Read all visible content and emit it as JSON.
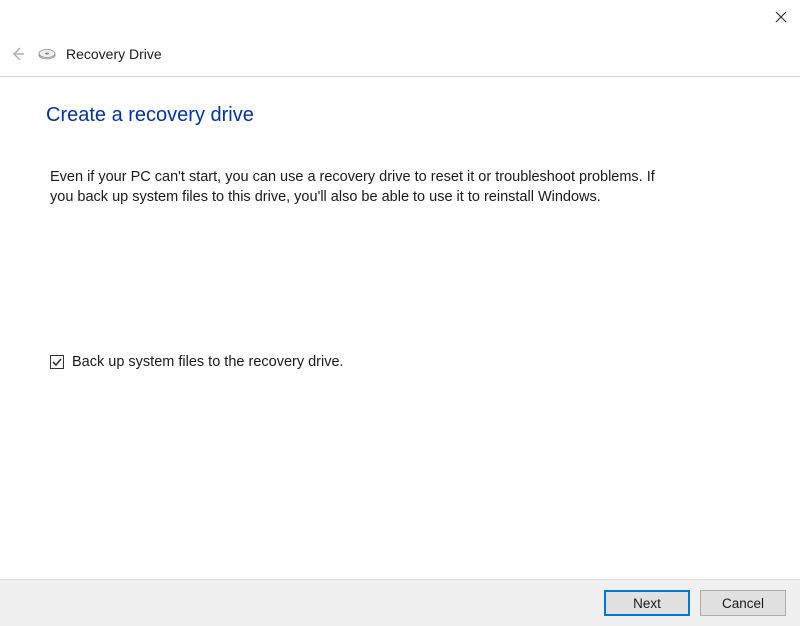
{
  "window": {
    "title": "Recovery Drive"
  },
  "page": {
    "heading": "Create a recovery drive",
    "body": "Even if your PC can't start, you can use a recovery drive to reset it or troubleshoot problems. If you back up system files to this drive, you'll also be able to use it to reinstall Windows."
  },
  "checkbox": {
    "label": "Back up system files to the recovery drive.",
    "checked": true
  },
  "footer": {
    "next": "Next",
    "cancel": "Cancel"
  }
}
